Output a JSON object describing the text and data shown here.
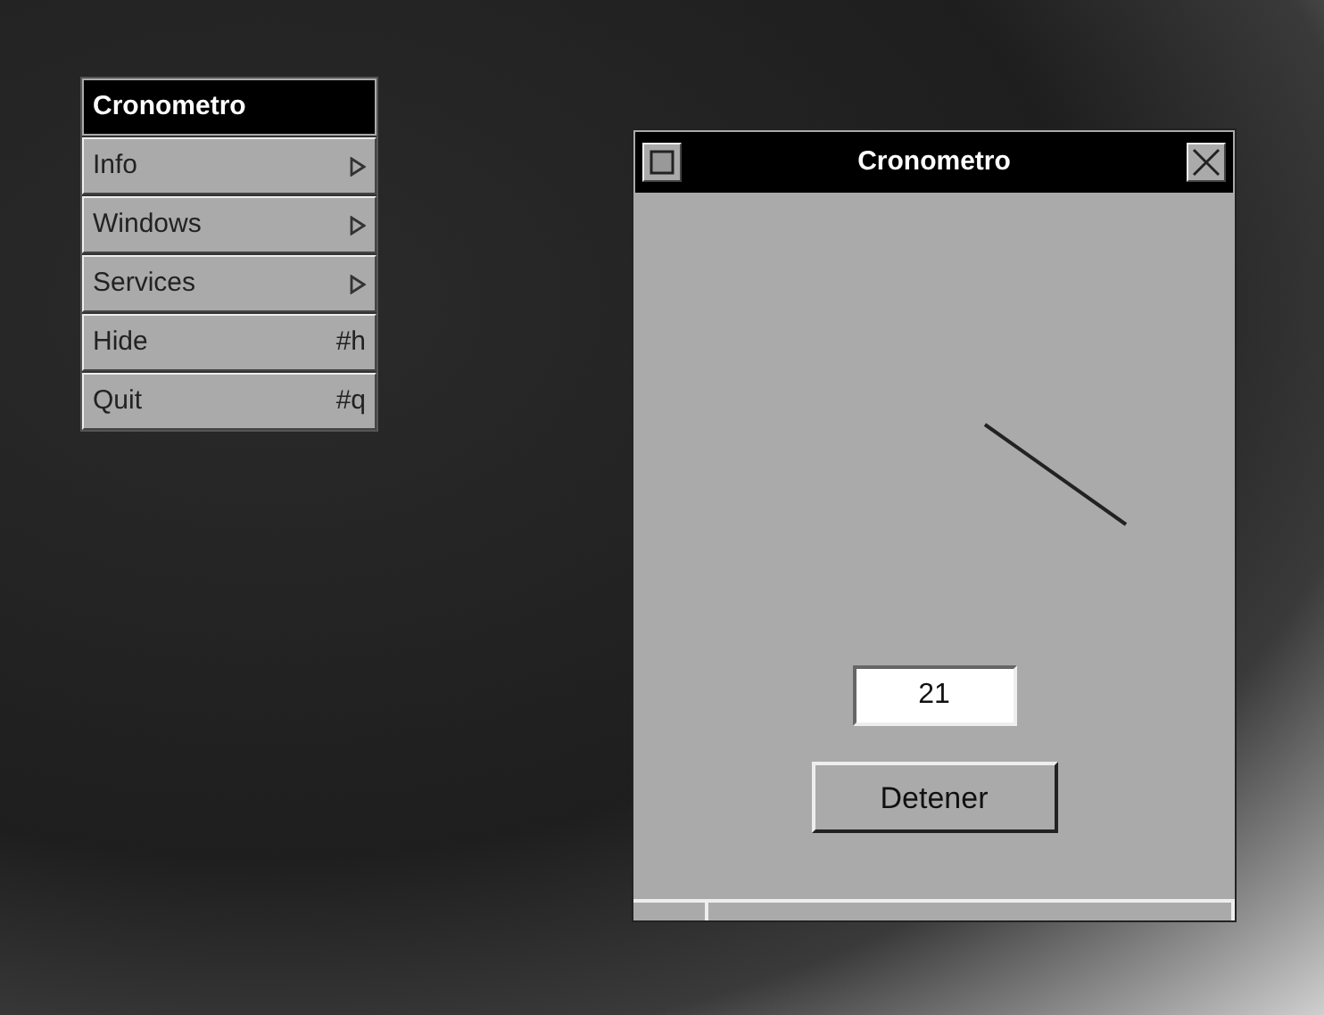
{
  "app_menu": {
    "title": "Cronometro",
    "items": [
      {
        "label": "Info",
        "kind": "submenu"
      },
      {
        "label": "Windows",
        "kind": "submenu"
      },
      {
        "label": "Services",
        "kind": "submenu"
      },
      {
        "label": "Hide",
        "kind": "shortcut",
        "shortcut": "#h"
      },
      {
        "label": "Quit",
        "kind": "shortcut",
        "shortcut": "#q"
      }
    ]
  },
  "window": {
    "title": "Cronometro",
    "counter": "21",
    "button": "Detener"
  }
}
